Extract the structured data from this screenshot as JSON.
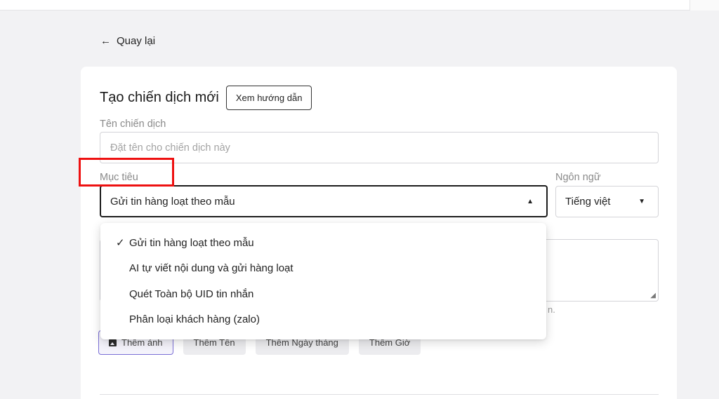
{
  "nav": {
    "back_label": "Quay lại"
  },
  "form": {
    "title": "Tạo chiến dịch mới",
    "guide_button": "Xem hướng dẫn",
    "name_label": "Tên chiến dịch",
    "name_placeholder": "Đặt tên cho chiến dịch này",
    "goal_label": "Mục tiêu",
    "goal_selected": "Gửi tin hàng loạt theo mẫu",
    "language_label": "Ngôn ngữ",
    "language_selected": "Tiếng việt",
    "hint_tail": "n."
  },
  "goal_options": [
    {
      "label": "Gửi tin hàng loạt theo mẫu",
      "selected": true
    },
    {
      "label": "AI tự viết nội dung và gửi hàng loạt",
      "selected": false
    },
    {
      "label": "Quét Toàn bộ UID tin nhắn",
      "selected": false
    },
    {
      "label": "Phân loại khách hàng (zalo)",
      "selected": false
    }
  ],
  "check_mark": "✓",
  "insert_buttons": [
    {
      "label": "Thêm ảnh",
      "icon": "image-icon"
    },
    {
      "label": "Thêm Tên"
    },
    {
      "label": "Thêm Ngày tháng"
    },
    {
      "label": "Thêm Giờ"
    }
  ],
  "colors": {
    "highlight": "#ee1111",
    "accent_border": "#7b6fd6"
  }
}
